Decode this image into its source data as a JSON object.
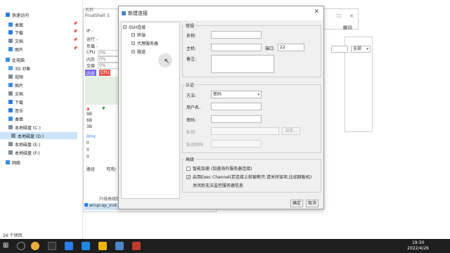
{
  "explorer": {
    "sidebar": [
      {
        "label": "快速访问",
        "level": 1,
        "icon": "star-icon",
        "color": "#2b7de9"
      },
      {
        "label": "桌面",
        "level": 2,
        "icon": "desktop-icon",
        "color": "#3a8ee6",
        "pinned": true
      },
      {
        "label": "下载",
        "level": 2,
        "icon": "download-icon",
        "color": "#2b7de9",
        "pinned": true
      },
      {
        "label": "文档",
        "level": 2,
        "icon": "document-icon",
        "color": "#7f8c9a",
        "pinned": true
      },
      {
        "label": "图片",
        "level": 2,
        "icon": "picture-icon",
        "color": "#3a8ee6",
        "pinned": true
      },
      {
        "label": "此电脑",
        "level": 1,
        "icon": "pc-icon",
        "color": "#3a8ee6"
      },
      {
        "label": "3D 对象",
        "level": 2,
        "icon": "3d-object-icon",
        "color": "#5aa0e8"
      },
      {
        "label": "视频",
        "level": 2,
        "icon": "video-icon",
        "color": "#7f8c9a"
      },
      {
        "label": "图片",
        "level": 2,
        "icon": "picture-icon",
        "color": "#3a8ee6"
      },
      {
        "label": "文档",
        "level": 2,
        "icon": "document-icon",
        "color": "#7f8c9a"
      },
      {
        "label": "下载",
        "level": 2,
        "icon": "download-icon",
        "color": "#2b7de9"
      },
      {
        "label": "音乐",
        "level": 2,
        "icon": "music-icon",
        "color": "#2b7de9"
      },
      {
        "label": "桌面",
        "level": 2,
        "icon": "desktop-icon",
        "color": "#3a8ee6"
      },
      {
        "label": "本地磁盘 (C:)",
        "level": 2,
        "icon": "drive-icon",
        "color": "#7f8c9a"
      },
      {
        "label": "本地磁盘 (D:)",
        "level": 2,
        "icon": "drive-icon",
        "color": "#7f8c9a",
        "selected": true
      },
      {
        "label": "本地磁盘 (E:)",
        "level": 2,
        "icon": "drive-icon",
        "color": "#7f8c9a"
      },
      {
        "label": "本地磁盘 (F:)",
        "level": 2,
        "icon": "drive-icon",
        "color": "#7f8c9a"
      },
      {
        "label": "网络",
        "level": 1,
        "icon": "network-icon",
        "color": "#3a8ee6"
      }
    ],
    "status": "26 个项目",
    "name_header": "名称",
    "file_item": "winpcap_inst"
  },
  "finalshell": {
    "title": "FinalShell 3.",
    "ip_label": "IP -",
    "run_label": "运行 -",
    "load_label": "负载 -",
    "cpu_label": "CPU",
    "cpu_value": "0%",
    "mem_label": "内存",
    "mem_value": "0%",
    "swap_label": "交换",
    "swap_value": "0%",
    "tab_mem": "内存",
    "tab_cpu": "CPU",
    "net_values": [
      "9B",
      "6B",
      "3B"
    ],
    "latency_label": "0ms",
    "latency_values": [
      "0",
      "0",
      "0"
    ],
    "path_label": "路径",
    "avail_label": "可用/",
    "upgrade_label": "升级高级版"
  },
  "right_window": {
    "filter_value": "全部"
  },
  "dialog": {
    "title": "新建连接",
    "tree": {
      "root": "SSH连接",
      "children": [
        "终端",
        "代理服务器",
        "隧道"
      ]
    },
    "general": {
      "title": "常规",
      "name_label": "名称:",
      "name_value": "",
      "host_label": "主机:",
      "host_value": "",
      "port_label": "端口:",
      "port_value": "22",
      "note_label": "备注:",
      "note_value": ""
    },
    "auth": {
      "title": "认证",
      "method_label": "方法:",
      "method_value": "密码",
      "user_label": "用户名:",
      "user_value": "",
      "password_label": "密码:",
      "password_value": "",
      "key_label": "私钥:",
      "browse_label": "浏览...",
      "key_password_label": "私钥密码"
    },
    "advanced": {
      "title": "高级",
      "smart_accel": {
        "label": "智能加速 (加速海外服务器连接)",
        "checked": false
      },
      "exec_channel": {
        "label": "启用Exec Channel(若连接上就被断开,请关闭该项,比如跳板机)",
        "checked": true
      },
      "no_monitor": {
        "label": "关闭后无法监控服务器信息"
      }
    },
    "ok_label": "确定",
    "cancel_label": "取消"
  },
  "taskbar": {
    "time": "19:30",
    "date": "2022/4/26"
  }
}
